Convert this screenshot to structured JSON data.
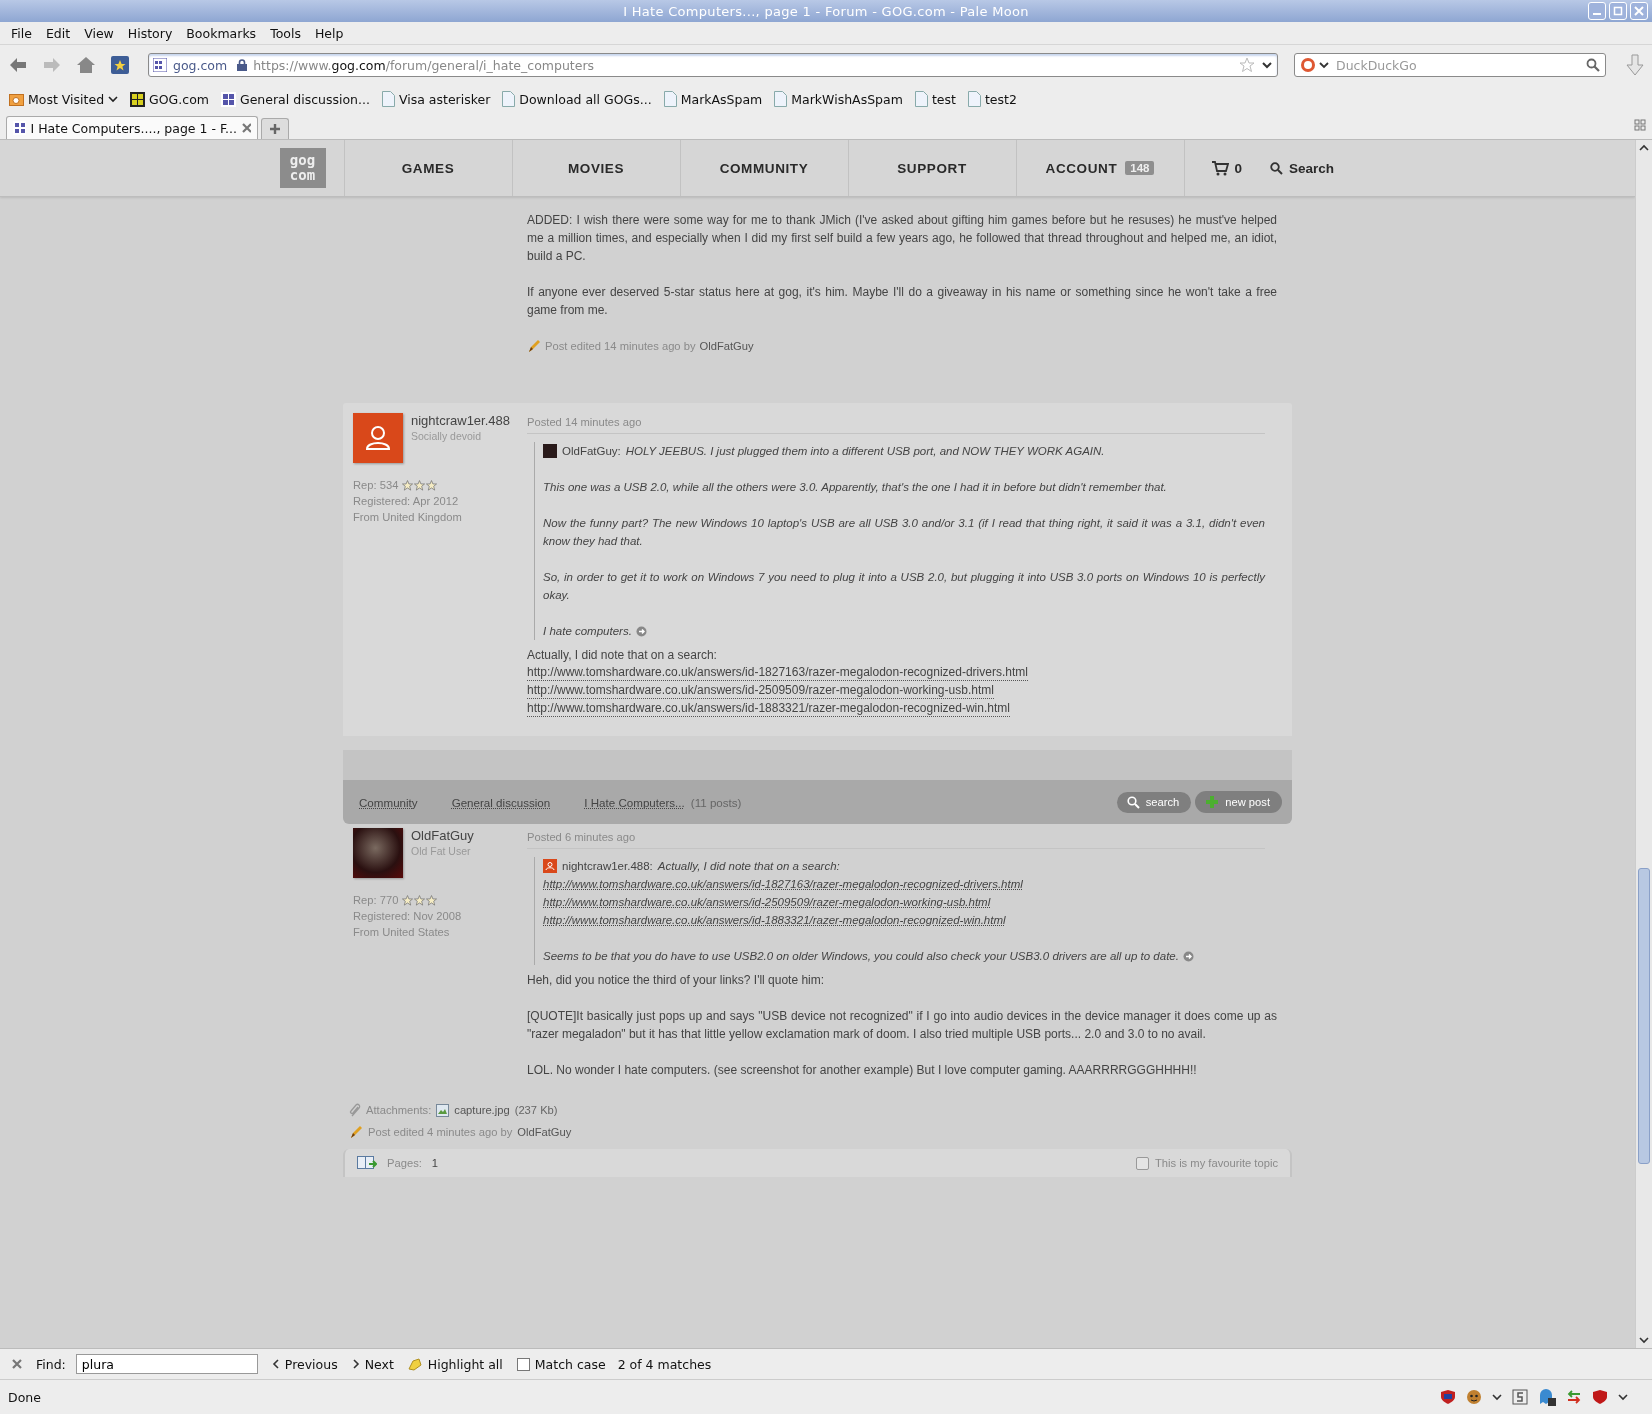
{
  "window": {
    "title": "I Hate Computers..., page 1 - Forum - GOG.com - Pale Moon"
  },
  "menu": [
    "File",
    "Edit",
    "View",
    "History",
    "Bookmarks",
    "Tools",
    "Help"
  ],
  "address_bar": {
    "site": "gog.com",
    "url_prefix": "https://www.",
    "url_domain": "gog.com",
    "url_path": "/forum/general/i_hate_computers"
  },
  "search_bar": {
    "placeholder": "DuckDuckGo"
  },
  "bookmarks": [
    {
      "label": "Most Visited",
      "kind": "folder"
    },
    {
      "label": "GOG.com",
      "kind": "gog"
    },
    {
      "label": "General discussion...",
      "kind": "site"
    },
    {
      "label": "Visa asterisker",
      "kind": "page"
    },
    {
      "label": "Download all GOGs...",
      "kind": "page"
    },
    {
      "label": "MarkAsSpam",
      "kind": "page"
    },
    {
      "label": "MarkWishAsSpam",
      "kind": "page"
    },
    {
      "label": "test",
      "kind": "page"
    },
    {
      "label": "test2",
      "kind": "page"
    }
  ],
  "tabs": [
    {
      "label": "I Hate Computers...., page 1 - F...",
      "selected": true
    }
  ],
  "site_nav": {
    "logo": [
      "gog",
      "com"
    ],
    "items": [
      {
        "label": "GAMES"
      },
      {
        "label": "MOVIES"
      },
      {
        "label": "COMMUNITY"
      },
      {
        "label": "SUPPORT"
      },
      {
        "label": "ACCOUNT",
        "badge": "148"
      }
    ],
    "cart": "0",
    "search": "Search"
  },
  "posts": [
    {
      "kind": "continued",
      "paragraphs": [
        "ADDED: I wish there were some way for me to thank JMich (I've asked about gifting him games before but he resuses) he must've helped me a million times, and especially when I did my first self build a few years ago, he followed that thread throughout and helped me, an idiot, build a PC.",
        "If anyone ever deserved 5-star status here at gog, it's him. Maybe I'll do a giveaway in his name or something since he won't take a free game from me."
      ],
      "edited": {
        "text": "Post edited 14 minutes ago by",
        "author": "OldFatGuy"
      }
    },
    {
      "kind": "full",
      "avatar": {
        "kind": "person"
      },
      "username": "nightcraw1er.488",
      "rank": "Socially devoid",
      "rep": "Rep: 534",
      "stars": 3,
      "registered": "Registered: Apr 2012",
      "from": "From United Kingdom",
      "posted": "Posted 14 minutes ago",
      "quote": {
        "avatar": {
          "kind": "image"
        },
        "author": "OldFatGuy:",
        "lead": "HOLY JEEBUS. I just plugged them into a different USB port, and NOW THEY WORK AGAIN.",
        "paragraphs": [
          "This one was a USB 2.0, while all the others were 3.0. Apparently, that's the one I had it in before but didn't remember that.",
          "Now the funny part? The new Windows 10 laptop's USB are all USB 3.0 and/or 3.1 (if I read that thing right, it said it was a 3.1, didn't even know they had that.",
          "So, in order to get it to work on Windows 7 you need to plug it into a USB 2.0, but plugging it into USB 3.0 ports on Windows 10 is perfectly okay.",
          "I hate computers."
        ]
      },
      "paragraphs": [
        "Actually, I did note that on a search:"
      ],
      "links": [
        "http://www.tomshardware.co.uk/answers/id-1827163/razer-megalodon-recognized-drivers.html",
        "http://www.tomshardware.co.uk/answers/id-2509509/razer-megalodon-working-usb.html",
        "http://www.tomshardware.co.uk/answers/id-1883321/razer-megalodon-recognized-win.html"
      ]
    },
    {
      "kind": "full",
      "avatar": {
        "kind": "image"
      },
      "username": "OldFatGuy",
      "rank": "Old Fat User",
      "rep": "Rep: 770",
      "stars": 3,
      "registered": "Registered: Nov 2008",
      "from": "From United States",
      "posted": "Posted 6 minutes ago",
      "quote": {
        "avatar": {
          "kind": "person"
        },
        "author": "nightcraw1er.488:",
        "lead": "Actually, I did note that on a search:",
        "links": [
          "http://www.tomshardware.co.uk/answers/id-1827163/razer-megalodon-recognized-drivers.html",
          "http://www.tomshardware.co.uk/answers/id-2509509/razer-megalodon-working-usb.html",
          "http://www.tomshardware.co.uk/answers/id-1883321/razer-megalodon-recognized-win.html"
        ],
        "paragraphs": [
          "Seems to be that you do have to use USB2.0 on older Windows, you could also check your USB3.0 drivers are all up to date."
        ]
      },
      "paragraphs": [
        "Heh, did you notice the third of your links? I'll quote him:",
        "[QUOTE]It basically just pops up and says \"USB device not recognized\" if I go into audio devices in the device manager it does come up as \"razer megaladon\" but it has that little yellow exclamation mark of doom. I also tried multiple USB ports... 2.0 and 3.0 to no avail.",
        "LOL. No wonder I hate computers. (see screenshot for another example) But I love computer gaming. AAARRRRGGGHHHH!!"
      ],
      "attachments": {
        "label": "Attachments:",
        "file": "capture.jpg",
        "size": "(237 Kb)"
      },
      "edited": {
        "text": "Post edited 4 minutes ago by",
        "author": "OldFatGuy"
      }
    }
  ],
  "breadcrumb": {
    "items": [
      "Community",
      "General discussion",
      "I Hate Computers..."
    ],
    "count": "(11 posts)",
    "search": "search",
    "new_post": "new post"
  },
  "pages_bar": {
    "label": "Pages:",
    "page": "1",
    "favourite": {
      "label": "This is my favourite topic",
      "checked": false
    }
  },
  "find_bar": {
    "label": "Find:",
    "value": "plura",
    "previous": "Previous",
    "next": "Next",
    "highlight": "Highlight all",
    "match_case": {
      "label": "Match case",
      "checked": false
    },
    "result": "2 of 4 matches"
  },
  "status_bar": {
    "text": "Done"
  }
}
